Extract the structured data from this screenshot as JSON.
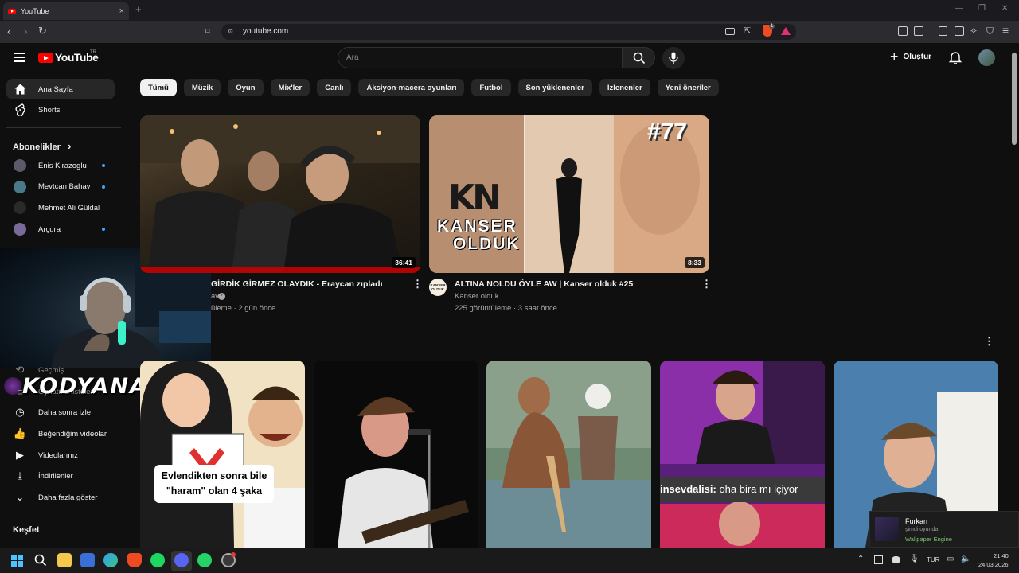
{
  "browser": {
    "tab_title": "YouTube",
    "tab_close": "×",
    "new_tab": "+",
    "url": "youtube.com",
    "brave_badge": "1"
  },
  "header": {
    "logo_text": "YouTube",
    "logo_region": "TR",
    "search_placeholder": "Ara",
    "create_label": "Oluştur"
  },
  "chips": [
    "Tümü",
    "Müzik",
    "Oyun",
    "Mix'ler",
    "Canlı",
    "Aksiyon-macera oyunları",
    "Futbol",
    "Son yüklenenler",
    "İzlenenler",
    "Yeni öneriler"
  ],
  "sidebar": {
    "main": [
      {
        "label": "Ana Sayfa",
        "icon": "home-icon"
      },
      {
        "label": "Shorts",
        "icon": "shorts-icon"
      }
    ],
    "subs_header": "Abonelikler",
    "subs_arrow": "›",
    "subscriptions": [
      {
        "label": "Enis Kirazoglu",
        "color": "#5a5a6a"
      },
      {
        "label": "Mevtcan Bahav",
        "color": "#4a7a8a"
      },
      {
        "label": "Mehmet Ali Güldal",
        "color": "#2a2a2a"
      },
      {
        "label": "Arçura",
        "color": "#7a6a9a"
      }
    ],
    "you_items": [
      {
        "label": "Geçmiş",
        "icon": "history-icon",
        "glyph": "⟲"
      },
      {
        "label": "Oynatma listeleri",
        "icon": "playlist-icon",
        "glyph": "≡"
      },
      {
        "label": "Daha sonra izle",
        "icon": "watch-later-icon",
        "glyph": "◷"
      },
      {
        "label": "Beğendiğim videolar",
        "icon": "like-icon",
        "glyph": "👍"
      },
      {
        "label": "Videolarınız",
        "icon": "your-videos-icon",
        "glyph": "▶"
      },
      {
        "label": "İndirilenler",
        "icon": "download-icon",
        "glyph": "⤓"
      },
      {
        "label": "Daha fazla göster",
        "icon": "chevron-down-icon",
        "glyph": "⌄"
      }
    ],
    "explore_header": "Keşfet"
  },
  "overlay": {
    "cam_logo": "KODYANA"
  },
  "videos": [
    {
      "title": "GİRDİK GİRMEZ OLAYDIK - Eraycan zıpladı",
      "channel": "av",
      "views": "üleme",
      "age": "2 gün önce",
      "duration": "36:41"
    },
    {
      "title": "ALTINA NOLDU ÖYLE AW | Kanser olduk #25",
      "channel": "Kanser olduk",
      "views": "225 görüntüleme",
      "age": "3 saat önce",
      "duration": "8:33",
      "thumb_number": "#77",
      "thumb_logo_top": "KN",
      "thumb_logo_bottom1": "KANSER",
      "thumb_logo_bottom2": "OLDUK",
      "avatar_text": "KANSER OLDUK"
    }
  ],
  "shorts": [
    {
      "caption_line1": "Evlendikten sonra bile",
      "caption_line2": "\"haram\" olan 4 şaka"
    },
    {},
    {},
    {
      "chat_user": "insevdalisi:",
      "chat_text": "oha bira mı içiyor"
    },
    {}
  ],
  "toast": {
    "name": "Furkan",
    "status": "şimdi oyunda",
    "game": "Wallpaper Engine"
  },
  "taskbar": {
    "lang": "TUR",
    "time": "21:40",
    "date": "24.03.2026"
  },
  "colors": {
    "brand_red": "#ff0000",
    "subscription_dot": "#3ea6ff",
    "toast_game": "#7cc86b"
  }
}
